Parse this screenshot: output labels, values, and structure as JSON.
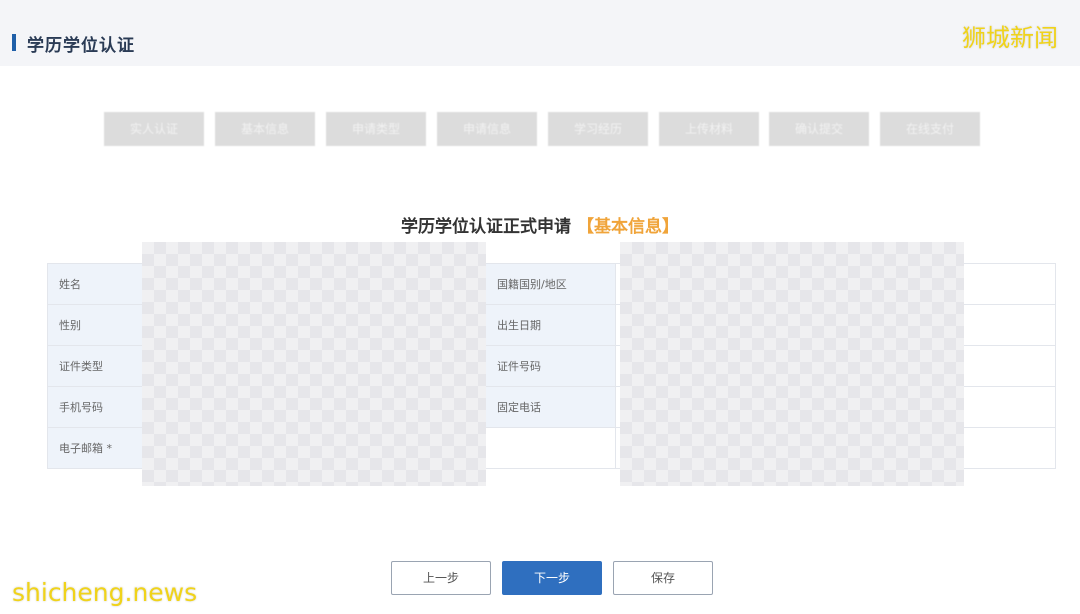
{
  "header": {
    "title": "学历学位认证"
  },
  "watermarks": {
    "top": "狮城新闻",
    "bottom": "shicheng.news"
  },
  "steps": [
    "实人认证",
    "基本信息",
    "申请类型",
    "申请信息",
    "学习经历",
    "上传材料",
    "确认提交",
    "在线支付"
  ],
  "form": {
    "heading": "学历学位认证正式申请",
    "heading_tag": "【基本信息】",
    "rows": [
      {
        "left_label": "姓名",
        "right_label": "国籍国别/地区"
      },
      {
        "left_label": "性别",
        "right_label": "出生日期"
      },
      {
        "left_label": "证件类型",
        "right_label": "证件号码"
      },
      {
        "left_label": "手机号码",
        "right_label": "固定电话"
      },
      {
        "left_label": "电子邮箱 *",
        "right_label": ""
      }
    ]
  },
  "actions": {
    "prev": "上一步",
    "next": "下一步",
    "save": "保存"
  },
  "colors": {
    "accent": "#2f6fbf",
    "tag": "#f0a43a",
    "watermark": "#f0d31a"
  }
}
